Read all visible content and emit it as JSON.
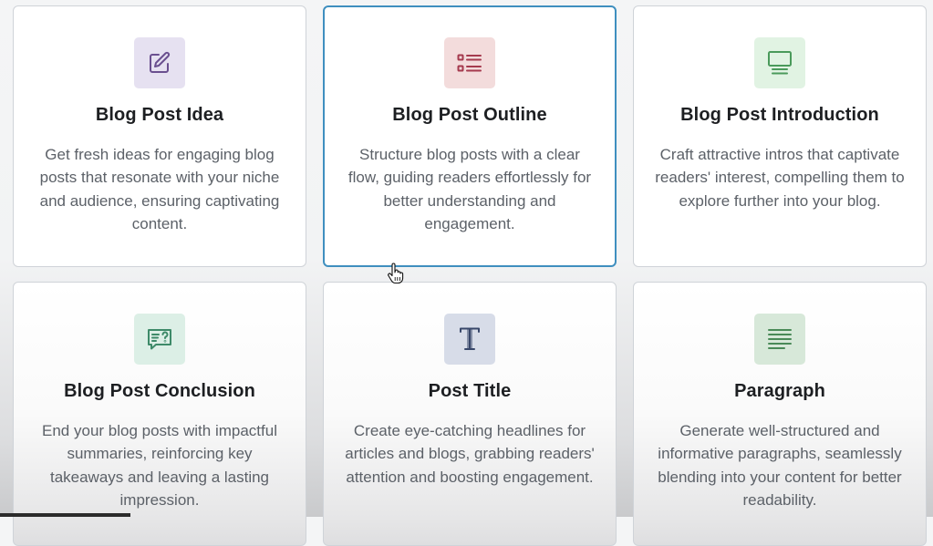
{
  "cards": [
    {
      "title": "Blog Post Idea",
      "description": "Get fresh ideas for engaging blog posts that resonate with your niche and audience, ensuring captivating content.",
      "icon": "edit-icon",
      "icon_bg": "#e6e1f1",
      "icon_color": "#6a4f8f",
      "selected": false
    },
    {
      "title": "Blog Post Outline",
      "description": "Structure blog posts with a clear flow, guiding readers effortlessly for better understanding and engagement.",
      "icon": "list-icon",
      "icon_bg": "#f3dcdc",
      "icon_color": "#a53a4e",
      "selected": true
    },
    {
      "title": "Blog Post Introduction",
      "description": "Craft attractive intros that captivate readers' interest, compelling them to explore further into your blog.",
      "icon": "document-icon",
      "icon_bg": "#e1f3e3",
      "icon_color": "#4a9a5b",
      "selected": false
    },
    {
      "title": "Blog Post Conclusion",
      "description": "End your blog posts with impactful summaries, reinforcing key takeaways and leaving a lasting impression.",
      "icon": "comment-question-icon",
      "icon_bg": "#dcefe6",
      "icon_color": "#3e8a69",
      "selected": false
    },
    {
      "title": "Post Title",
      "description": "Create eye-catching headlines for articles and blogs, grabbing readers' attention and boosting engagement.",
      "icon": "text-t-icon",
      "icon_bg": "#d7dce8",
      "icon_color": "#38476a",
      "selected": false
    },
    {
      "title": "Paragraph",
      "description": "Generate well-structured and informative paragraphs, seamlessly blending into your content for better readability.",
      "icon": "lines-icon",
      "icon_bg": "#d7e8d9",
      "icon_color": "#4a8a58",
      "selected": false
    }
  ],
  "colors": {
    "selected_border": "#3f8fbf",
    "card_border": "#cfd3d8",
    "title": "#1d1f22",
    "description": "#5c6168"
  }
}
